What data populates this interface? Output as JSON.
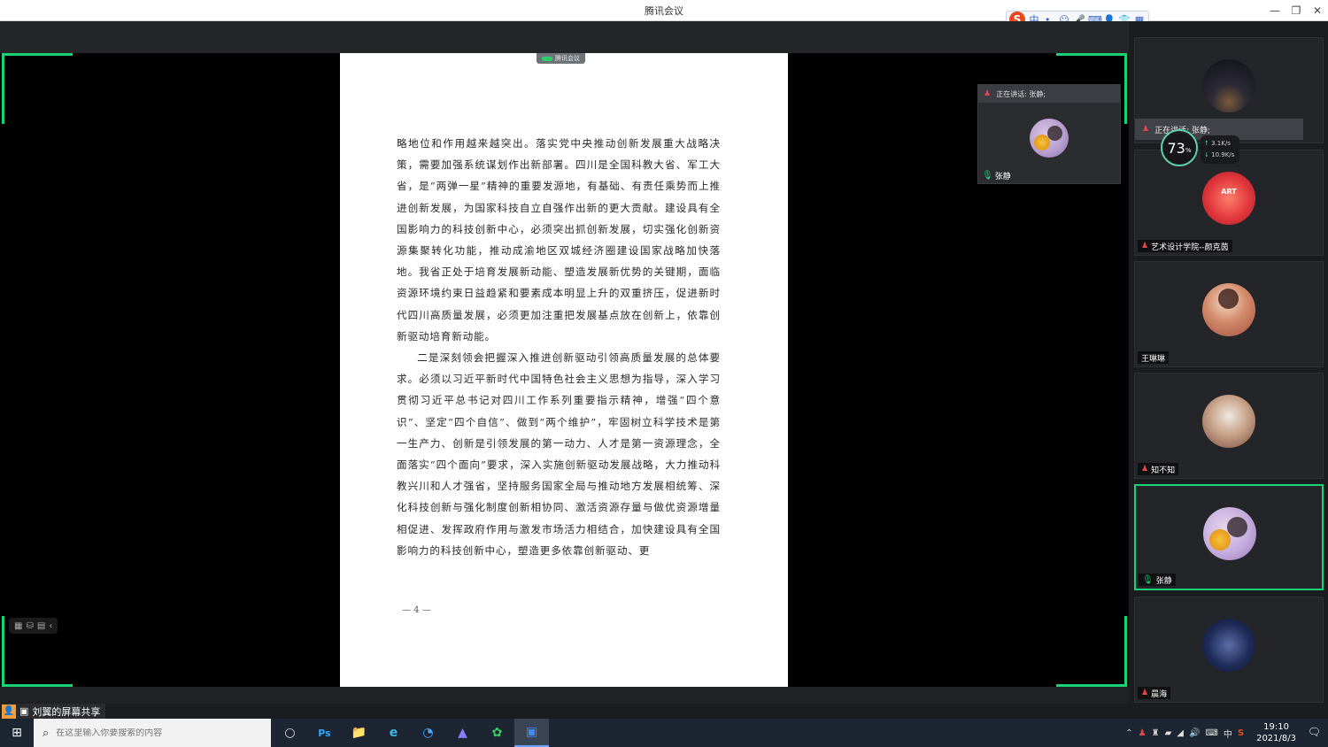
{
  "window": {
    "title": "腾讯会议",
    "controls": {
      "minimize": "—",
      "restore": "❐",
      "close": "✕"
    }
  },
  "ime": {
    "logo": "S",
    "items": [
      "中",
      "•,",
      "☺",
      "🎤",
      "⌨",
      "👤",
      "👕",
      "▦"
    ]
  },
  "share": {
    "doc_tag": "腾讯会议",
    "paragraph1": "略地位和作用越来越突出。落实党中央推动创新发展重大战略决策，需要加强系统谋划作出新部署。四川是全国科教大省、军工大省，是“两弹一星”精神的重要发源地，有基础、有责任乘势而上推进创新发展，为国家科技自立自强作出新的更大贡献。建设具有全国影响力的科技创新中心，必须突出抓创新发展，切实强化创新资源集聚转化功能，推动成渝地区双城经济圈建设国家战略加快落地。我省正处于培育发展新动能、塑造发展新优势的关键期，面临资源环境约束日益趋紧和要素成本明显上升的双重挤压，促进新时代四川高质量发展，必须更加注重把发展基点放在创新上，依靠创新驱动培育新动能。",
    "paragraph2": "二是深刻领会把握深入推进创新驱动引领高质量发展的总体要求。必须以习近平新时代中国特色社会主义思想为指导，深入学习贯彻习近平总书记对四川工作系列重要指示精神，增强“四个意识”、坚定“四个自信”、做到“两个维护”，牢固树立科学技术是第一生产力、创新是引领发展的第一动力、人才是第一资源理念，全面落实“四个面向”要求，深入实施创新驱动发展战略，大力推动科教兴川和人才强省，坚持服务国家全局与推动地方发展相统筹、深化科技创新与强化制度创新相协同、激活资源存量与做优资源增量相促进、发挥政府作用与激发市场活力相结合，加快建设具有全国影响力的科技创新中心，塑造更多依靠创新驱动、更",
    "page_number": "— 4 —",
    "tools": [
      "▦",
      "⛁",
      "▤",
      "‹"
    ]
  },
  "floating_speaker": {
    "speaking_label": "正在讲话: 张静;",
    "name": "张静"
  },
  "overlay": {
    "speaking_label": "正在讲话: 张静;",
    "gauge_value": "73",
    "gauge_unit": "%",
    "upload": "3.1K/s",
    "download": "10.9K/s"
  },
  "participants": [
    {
      "name": "",
      "avatar": "dusk",
      "mic": "none"
    },
    {
      "name": "艺术设计学院--颜克茵",
      "avatar": "red",
      "mic": "muted",
      "avatar_text": "ART"
    },
    {
      "name": "王琳琳",
      "avatar": "girl",
      "mic": "none"
    },
    {
      "name": "知不知",
      "avatar": "cup",
      "mic": "muted"
    },
    {
      "name": "张静",
      "avatar": "flower",
      "mic": "active"
    },
    {
      "name": "晨海",
      "avatar": "night",
      "mic": "muted"
    }
  ],
  "sharebar": {
    "label": "刘翼的屏幕共享"
  },
  "taskbar": {
    "start_icon": "⊞",
    "search_icon": "⌕",
    "search_placeholder": "在这里输入你要搜索的内容",
    "apps": [
      "○",
      "Ps",
      "📁",
      "e",
      "◔",
      "▲",
      "✿",
      "▣"
    ],
    "tray": [
      "⌃",
      "♟",
      "♜",
      "▰",
      "◢",
      "🔊",
      "⌨",
      "中",
      "S"
    ],
    "time": "19:10",
    "date": "2021/8/3",
    "notification_icon": "🗨"
  }
}
